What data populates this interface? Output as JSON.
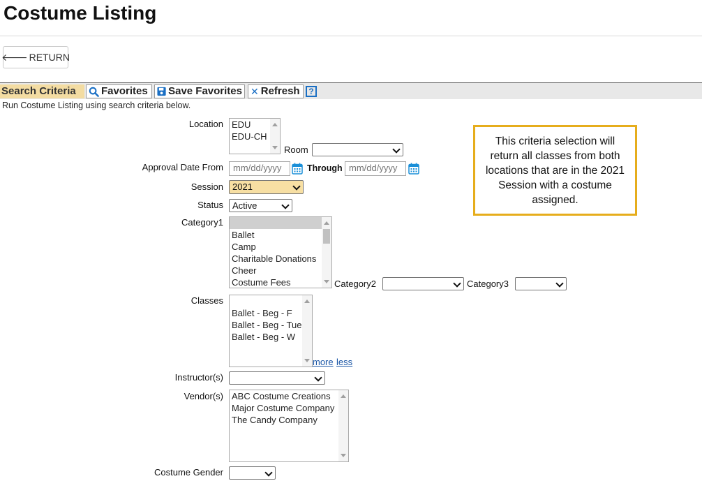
{
  "page": {
    "title": "Costume Listing",
    "return_label": "RETURN"
  },
  "toolbar": {
    "search_criteria": "Search Criteria",
    "favorites": "Favorites",
    "save_favorites": "Save Favorites",
    "refresh": "Refresh",
    "help": "?"
  },
  "subtext": "Run Costume Listing using search criteria below.",
  "fields": {
    "location": {
      "label": "Location",
      "options": [
        "EDU",
        "EDU-CH"
      ]
    },
    "room": {
      "label": "Room",
      "value": ""
    },
    "approval_date_from": {
      "label": "Approval Date From",
      "placeholder": "mm/dd/yyyy"
    },
    "through": {
      "label": "Through",
      "placeholder": "mm/dd/yyyy"
    },
    "session": {
      "label": "Session",
      "value": "2021",
      "highlight": "#f7dfa3"
    },
    "status": {
      "label": "Status",
      "value": "Active"
    },
    "category1": {
      "label": "Category1",
      "options": [
        "",
        "Ballet",
        "Camp",
        "Charitable Donations",
        "Cheer",
        "Costume Fees"
      ]
    },
    "category2": {
      "label": "Category2",
      "value": ""
    },
    "category3": {
      "label": "Category3",
      "value": ""
    },
    "classes": {
      "label": "Classes",
      "options": [
        "",
        "Ballet - Beg - F",
        "Ballet - Beg - Tue",
        "Ballet - Beg - W"
      ],
      "more": "more",
      "less": "less"
    },
    "instructors": {
      "label": "Instructor(s)",
      "value": ""
    },
    "vendors": {
      "label": "Vendor(s)",
      "options": [
        "ABC Costume Creations",
        "Major Costume Company",
        "The Candy Company"
      ]
    },
    "costume_gender": {
      "label": "Costume Gender",
      "value": ""
    }
  },
  "callout": {
    "lines": [
      "This criteria selection will",
      "return all classes from both",
      "locations that are in the 2021",
      "Session with a costume",
      "assigned."
    ],
    "border_color": "#e6ad1c"
  },
  "icons": [
    "arrow-left-icon",
    "search-icon",
    "save-icon",
    "close-icon",
    "help-icon",
    "calendar-icon"
  ]
}
